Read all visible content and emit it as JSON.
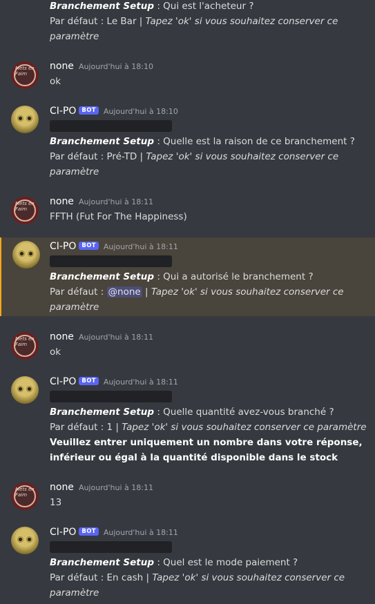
{
  "users": {
    "none": "none",
    "bot": "CI-PO",
    "bot_badge": "BOT"
  },
  "avatar_text": "Mets en Faim",
  "top_message": {
    "bold": "Branchement Setup",
    "question": " : Qui est l'acheteur ?",
    "default_prefix": "Par défaut : Le Bar | ",
    "default_hint": "Tapez 'ok' si vous souhaitez conserver ce paramètre"
  },
  "messages": [
    {
      "author": "none",
      "time": "Aujourd'hui à 18:10",
      "text": "ok"
    },
    {
      "author": "bot",
      "time": "Aujourd'hui à 18:10",
      "bold": "Branchement Setup",
      "question": " : Quelle est la raison de ce branchement ?",
      "default_prefix": "Par défaut : Pré-TD | ",
      "default_hint": "Tapez 'ok' si vous souhaitez conserver ce paramètre"
    },
    {
      "author": "none",
      "time": "Aujourd'hui à 18:11",
      "text": "FFTH (Fut For The Happiness)"
    },
    {
      "author": "bot",
      "time": "Aujourd'hui à 18:11",
      "bold": "Branchement Setup",
      "question": " : Qui a autorisé le branchement ?",
      "default_prefix": "Par défaut : ",
      "mention": "@none",
      "mention_sep": " | ",
      "default_hint": "Tapez 'ok' si vous souhaitez conserver ce paramètre"
    },
    {
      "author": "none",
      "time": "Aujourd'hui à 18:11",
      "text": "ok"
    },
    {
      "author": "bot",
      "time": "Aujourd'hui à 18:11",
      "bold": "Branchement Setup",
      "question": " : Quelle quantité avez-vous branché ?",
      "default_prefix": "Par défaut : 1 | ",
      "default_hint": "Tapez 'ok' si vous souhaitez conserver ce paramètre",
      "warning": "Veuillez entrer uniquement un nombre dans votre réponse, inférieur ou égal à la quantité disponible dans le stock"
    },
    {
      "author": "none",
      "time": "Aujourd'hui à 18:11",
      "text": "13"
    },
    {
      "author": "bot",
      "time": "Aujourd'hui à 18:11",
      "bold": "Branchement Setup",
      "question": " : Quel est le mode paiement ?",
      "default_prefix": "Par défaut : En cash | ",
      "default_hint": "Tapez 'ok' si vous souhaitez conserver ce paramètre"
    }
  ]
}
